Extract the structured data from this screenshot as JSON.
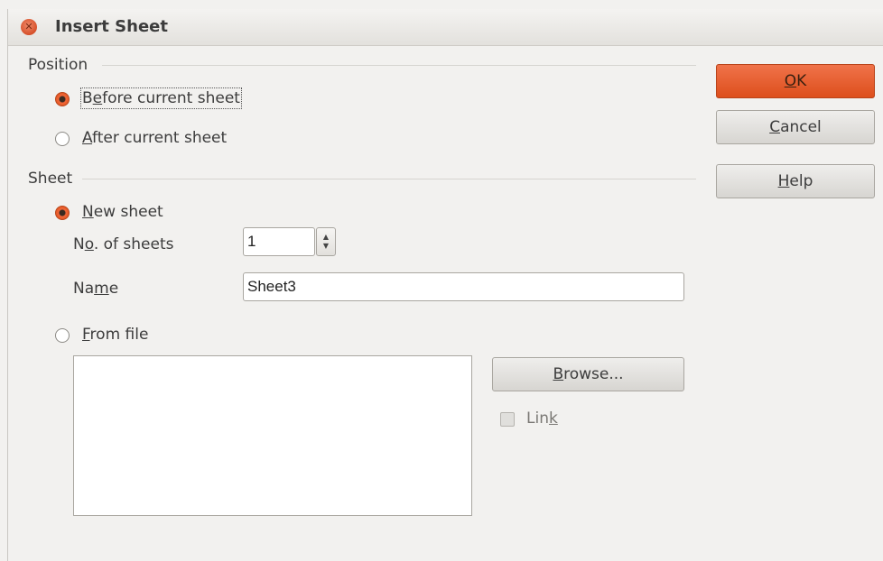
{
  "window": {
    "title": "Insert Sheet"
  },
  "position": {
    "label": "Position",
    "before_label": "Before current sheet",
    "after_label": "After current sheet",
    "selected": "before"
  },
  "sheet": {
    "label": "Sheet",
    "new_sheet_label": "New sheet",
    "num_sheets_label": "No. of sheets",
    "num_sheets_value": "1",
    "name_label": "Name",
    "name_value": "Sheet3",
    "from_file_label": "From file",
    "browse_label": "Browse...",
    "link_label": "Link",
    "link_checked": false,
    "selected": "new"
  },
  "buttons": {
    "ok_label": "OK",
    "cancel_label": "Cancel",
    "help_label": "Help"
  },
  "colors": {
    "accent": "#dd4f1c",
    "background": "#f2f1ef"
  }
}
